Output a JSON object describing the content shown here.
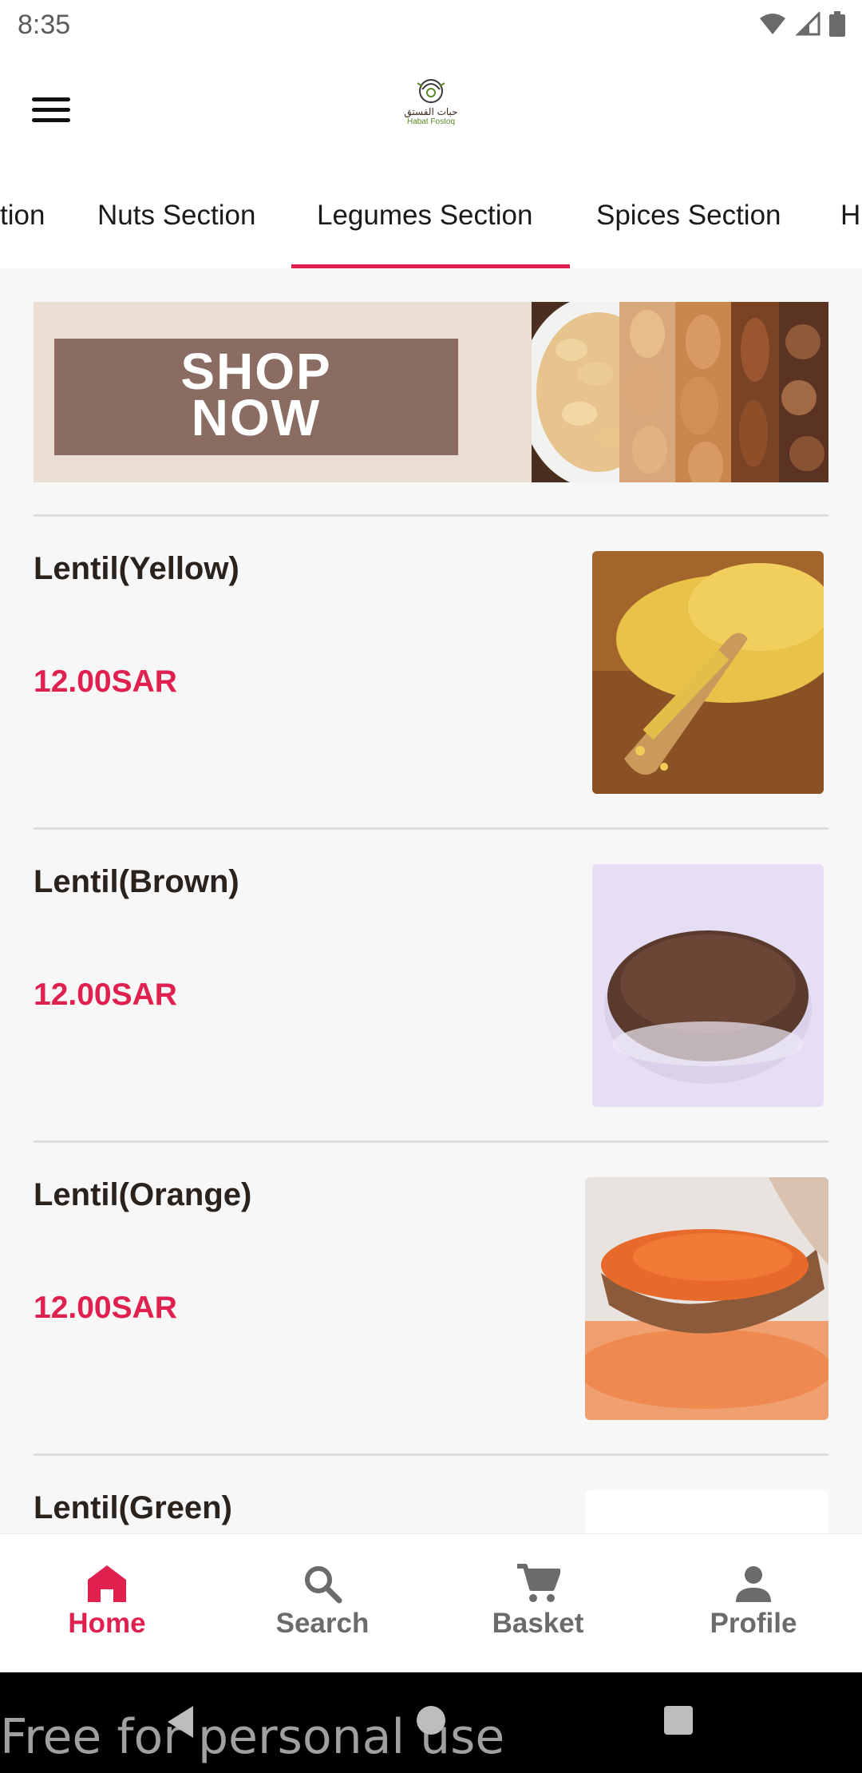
{
  "status_bar": {
    "time": "8:35"
  },
  "header": {
    "logo": {
      "arabic": "حبات الفستق",
      "english": "Habat Fostoq"
    }
  },
  "tabs": [
    {
      "label": "tion"
    },
    {
      "label": "Nuts Section"
    },
    {
      "label": "Legumes Section",
      "active": true
    },
    {
      "label": "Spices Section"
    },
    {
      "label": "H"
    }
  ],
  "banner": {
    "text_line1": "SHOP",
    "text_line2": "NOW"
  },
  "products": [
    {
      "name": "Lentil(Yellow)",
      "price": "12.00SAR"
    },
    {
      "name": "Lentil(Brown)",
      "price": "12.00SAR"
    },
    {
      "name": "Lentil(Orange)",
      "price": "12.00SAR"
    },
    {
      "name": "Lentil(Green)",
      "price": ""
    }
  ],
  "bottom_nav": [
    {
      "label": "Home",
      "icon": "home-icon",
      "active": true
    },
    {
      "label": "Search",
      "icon": "search-icon"
    },
    {
      "label": "Basket",
      "icon": "cart-icon"
    },
    {
      "label": "Profile",
      "icon": "person-icon"
    }
  ],
  "watermark": "Free for personal use",
  "colors": {
    "accent": "#e0204e",
    "inactive": "#6b6b6b",
    "text": "#2a231d"
  }
}
